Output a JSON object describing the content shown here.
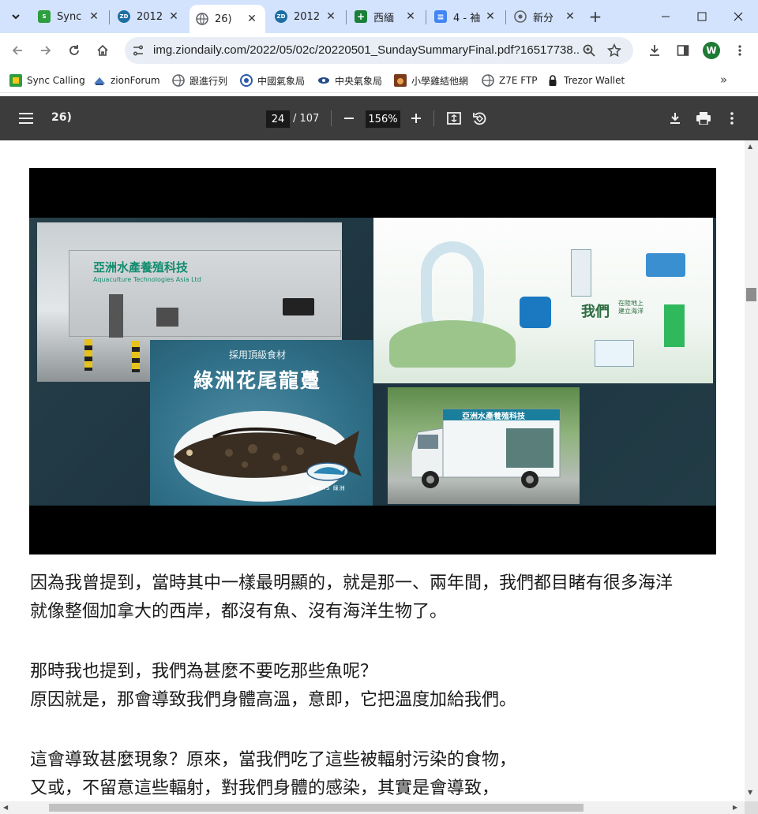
{
  "tabs": [
    {
      "title": "Sync",
      "favicon": "sync-calling-favicon",
      "color": "#2e9e3e",
      "label": "S"
    },
    {
      "title": "2012",
      "favicon": "zion-favicon",
      "color": "#1c6ea4",
      "label": "ZD"
    },
    {
      "title": "26)",
      "favicon": "globe-favicon",
      "color": "#5f6368",
      "label": ""
    },
    {
      "title": "2012",
      "favicon": "zion-favicon",
      "color": "#1c6ea4",
      "label": "ZD"
    },
    {
      "title": "西緬",
      "favicon": "sheets-favicon",
      "color": "#188038",
      "label": "+"
    },
    {
      "title": "4 - 袖",
      "favicon": "docs-favicon",
      "color": "#4285f4",
      "label": "≡"
    },
    {
      "title": "新分",
      "favicon": "chrome-favicon",
      "color": "#5f6368",
      "label": ""
    }
  ],
  "address_bar": {
    "url": "img.ziondaily.com/2022/05/02c/20220501_SundaySummaryFinal.pdf?16517738..."
  },
  "profile_initial": "W",
  "bookmarks": [
    {
      "label": "Sync Calling",
      "icon": "sync-calling-icon"
    },
    {
      "label": "zionForum",
      "icon": "zionforum-icon"
    },
    {
      "label": "跟進行列",
      "icon": "globe-icon"
    },
    {
      "label": "中國氣象局",
      "icon": "cma-icon"
    },
    {
      "label": "中央氣象局",
      "icon": "cwb-icon"
    },
    {
      "label": "小學雞結他網",
      "icon": "guitar-icon"
    },
    {
      "label": "Z7E FTP",
      "icon": "globe-icon"
    },
    {
      "label": "Trezor Wallet",
      "icon": "lock-icon"
    }
  ],
  "pdf_toolbar": {
    "title": "26)",
    "current_page": "24",
    "total_pages": "/ 107",
    "zoom": "156%"
  },
  "page_image": {
    "logo_text": "亞洲水產養殖科技",
    "logo_sub": "Aquaculture Technologies Asia Ltd",
    "dish_caption": "採用頂級食材",
    "dish_name": "綠洲花尾龍躉",
    "brand": "OASIS 綠洲",
    "infographic_heading": "我們",
    "infographic_sub": "在陸地上\n建立海洋",
    "truck_logo": "亞洲水產養殖科技"
  },
  "body_text": [
    "因為我曾提到，當時其中一樣最明顯的，就是那一、兩年間，我們都目睹有很多海洋",
    "就像整個加拿大的西岸，都沒有魚、沒有海洋生物了。",
    "",
    "那時我也提到，我們為甚麼不要吃那些魚呢？",
    "原因就是，那會導致我們身體高溫，意即，它把溫度加給我們。",
    "",
    "這會導致甚麼現象？原來，當我們吃了這些被輻射污染的食物，",
    "又或，不留意這些輻射，對我們身體的感染，其實是會導致，"
  ]
}
